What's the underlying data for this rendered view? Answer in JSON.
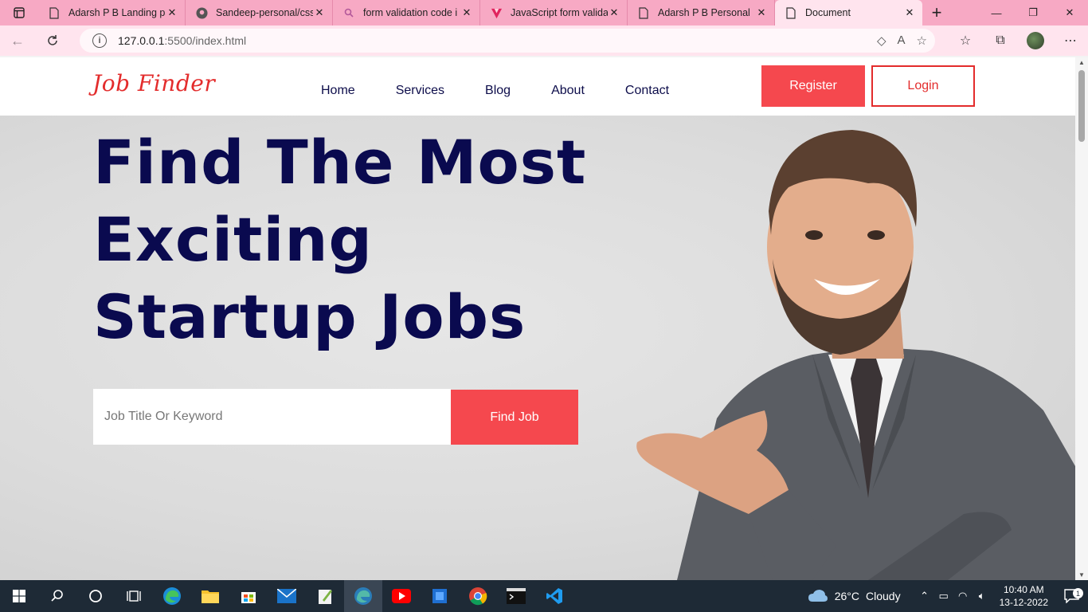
{
  "browser": {
    "tabs": [
      {
        "title": "Adarsh P B Landing pa",
        "icon": "page-icon",
        "active": false
      },
      {
        "title": "Sandeep-personal/css",
        "icon": "github-icon",
        "active": false
      },
      {
        "title": "form validation code i",
        "icon": "search-icon",
        "active": false
      },
      {
        "title": "JavaScript form validat",
        "icon": "vite-icon",
        "active": false
      },
      {
        "title": "Adarsh P B Personal",
        "icon": "page-icon",
        "active": false
      },
      {
        "title": "Document",
        "icon": "page-icon",
        "active": true
      }
    ],
    "url_host": "127.0.0.1",
    "url_rest": ":5500/index.html"
  },
  "site": {
    "logo": "Job Finder",
    "nav": [
      "Home",
      "Services",
      "Blog",
      "About",
      "Contact"
    ],
    "register_label": "Register",
    "login_label": "Login",
    "hero_lines": [
      "Find The Most",
      "Exciting",
      "Startup Jobs"
    ],
    "search_placeholder": "Job Title Or Keyword",
    "find_label": "Find Job"
  },
  "taskbar": {
    "weather_temp": "26°C",
    "weather_text": "Cloudy",
    "time": "10:40 AM",
    "date": "13-12-2022",
    "notifications": "1"
  },
  "colors": {
    "tabbar": "#f7a9c4",
    "accent_red": "#f5484e",
    "heading_navy": "#0a0a4f"
  }
}
